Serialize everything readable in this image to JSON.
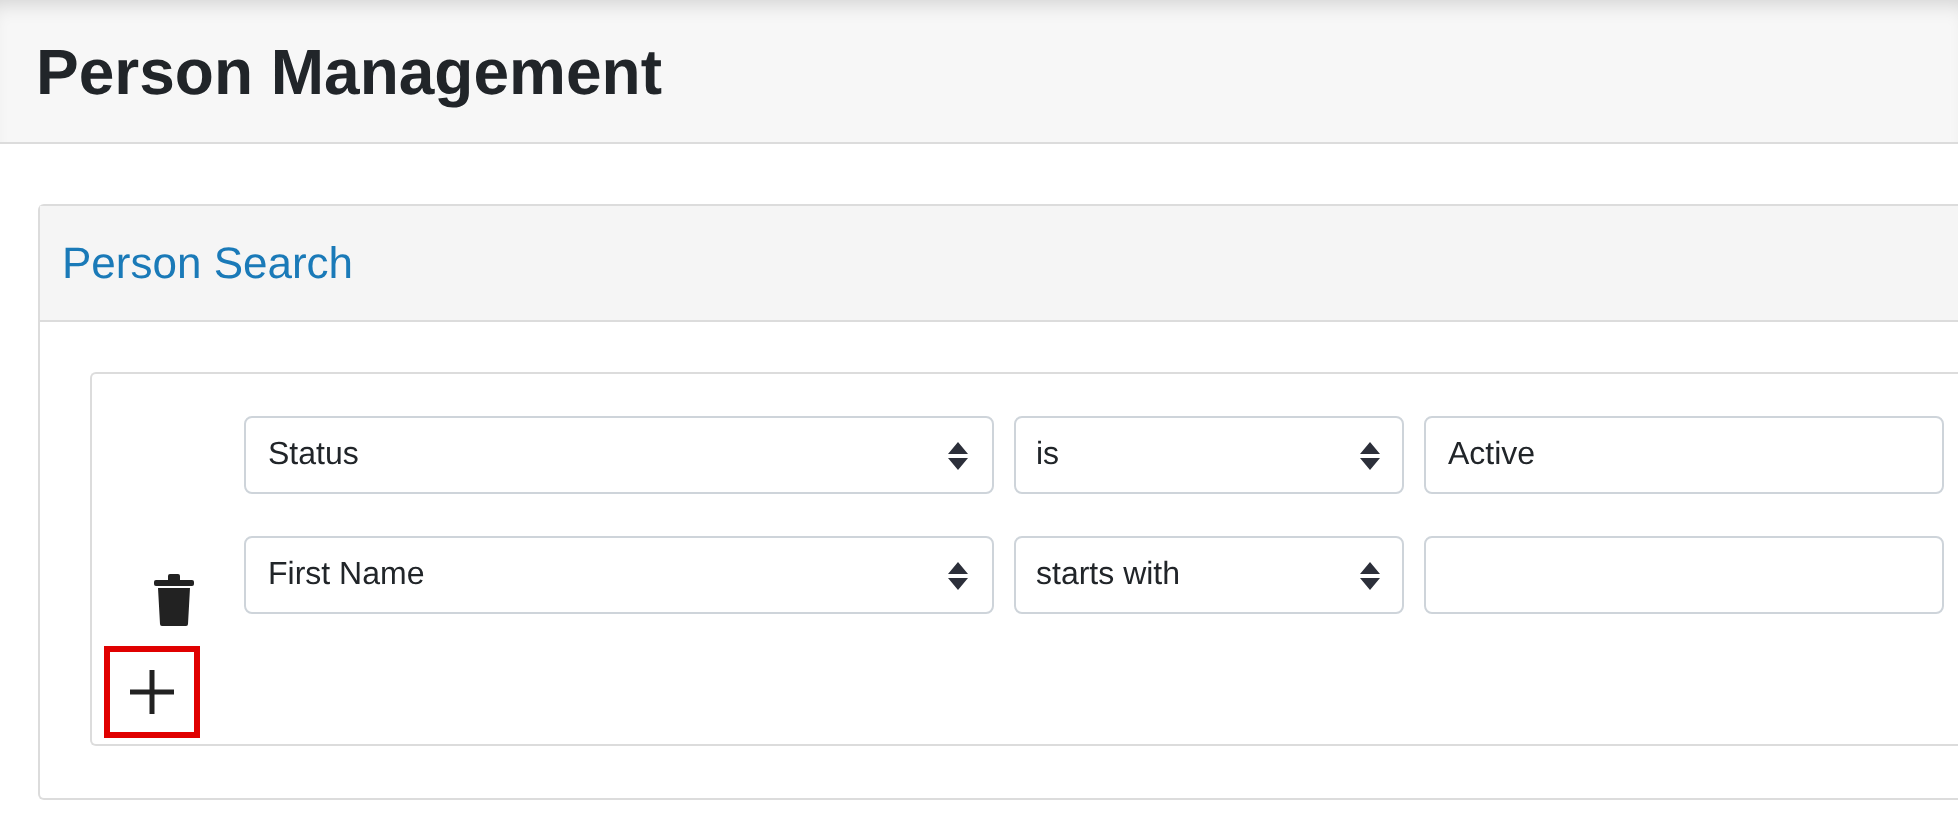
{
  "page": {
    "title": "Person Management"
  },
  "panel": {
    "title": "Person Search"
  },
  "filters": [
    {
      "field": "Status",
      "operator": "is",
      "value": "Active",
      "removable": false
    },
    {
      "field": "First Name",
      "operator": "starts with",
      "removable": true
    }
  ],
  "add_button": {
    "highlighted": true
  }
}
